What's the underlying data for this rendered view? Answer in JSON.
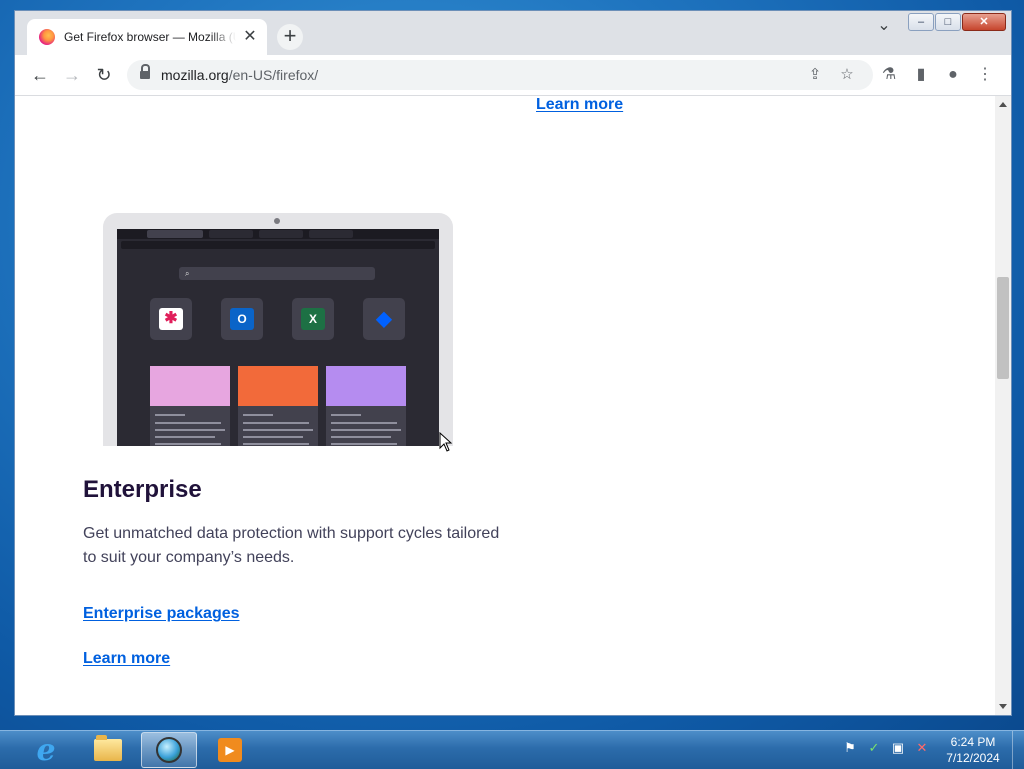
{
  "browser": {
    "tab": {
      "title": "Get Firefox browser — Mozilla (US)",
      "close_glyph": "✕"
    },
    "new_tab_glyph": "+",
    "window_controls": {
      "minimize": "–",
      "maximize": "□",
      "close": "✕",
      "tab_search": "⌄"
    },
    "toolbar": {
      "back": "←",
      "forward": "→",
      "reload": "↻",
      "url_domain": "mozilla.org",
      "url_path": "/en-US/firefox/",
      "share_icon": "⇪",
      "bookmark_icon": "☆",
      "extension_icon": "⚗",
      "sidepanel_icon": "▮",
      "profile_icon": "●",
      "menu_icon": "⋮"
    }
  },
  "page": {
    "top_link": "Learn more",
    "section": {
      "heading": "Enterprise",
      "description": "Get unmatched data protection with support cycles tailored to suit your company’s needs.",
      "link_packages": "Enterprise packages",
      "link_learn": "Learn more"
    },
    "mockup": {
      "apps": [
        {
          "name": "slack-icon",
          "glyph": "✱",
          "color": "#4a154b"
        },
        {
          "name": "outlook-icon",
          "glyph": "O",
          "color": "#0a64c8"
        },
        {
          "name": "excel-icon",
          "glyph": "X",
          "color": "#1d7044"
        },
        {
          "name": "dropbox-icon",
          "glyph": "◆",
          "color": "#0061fe"
        }
      ],
      "card_colors": [
        "#e7a6e0",
        "#f26a3a",
        "#b58cf0"
      ]
    }
  },
  "taskbar": {
    "ie_glyph": "e",
    "media_glyph": "▶",
    "tray": {
      "flag": "⚑",
      "security": "✓",
      "network": "▣",
      "volume": "✕"
    },
    "time": "6:24 PM",
    "date": "7/12/2024"
  },
  "colors": {
    "link": "#0060df",
    "heading": "#20123a",
    "body_text": "#42425a"
  }
}
